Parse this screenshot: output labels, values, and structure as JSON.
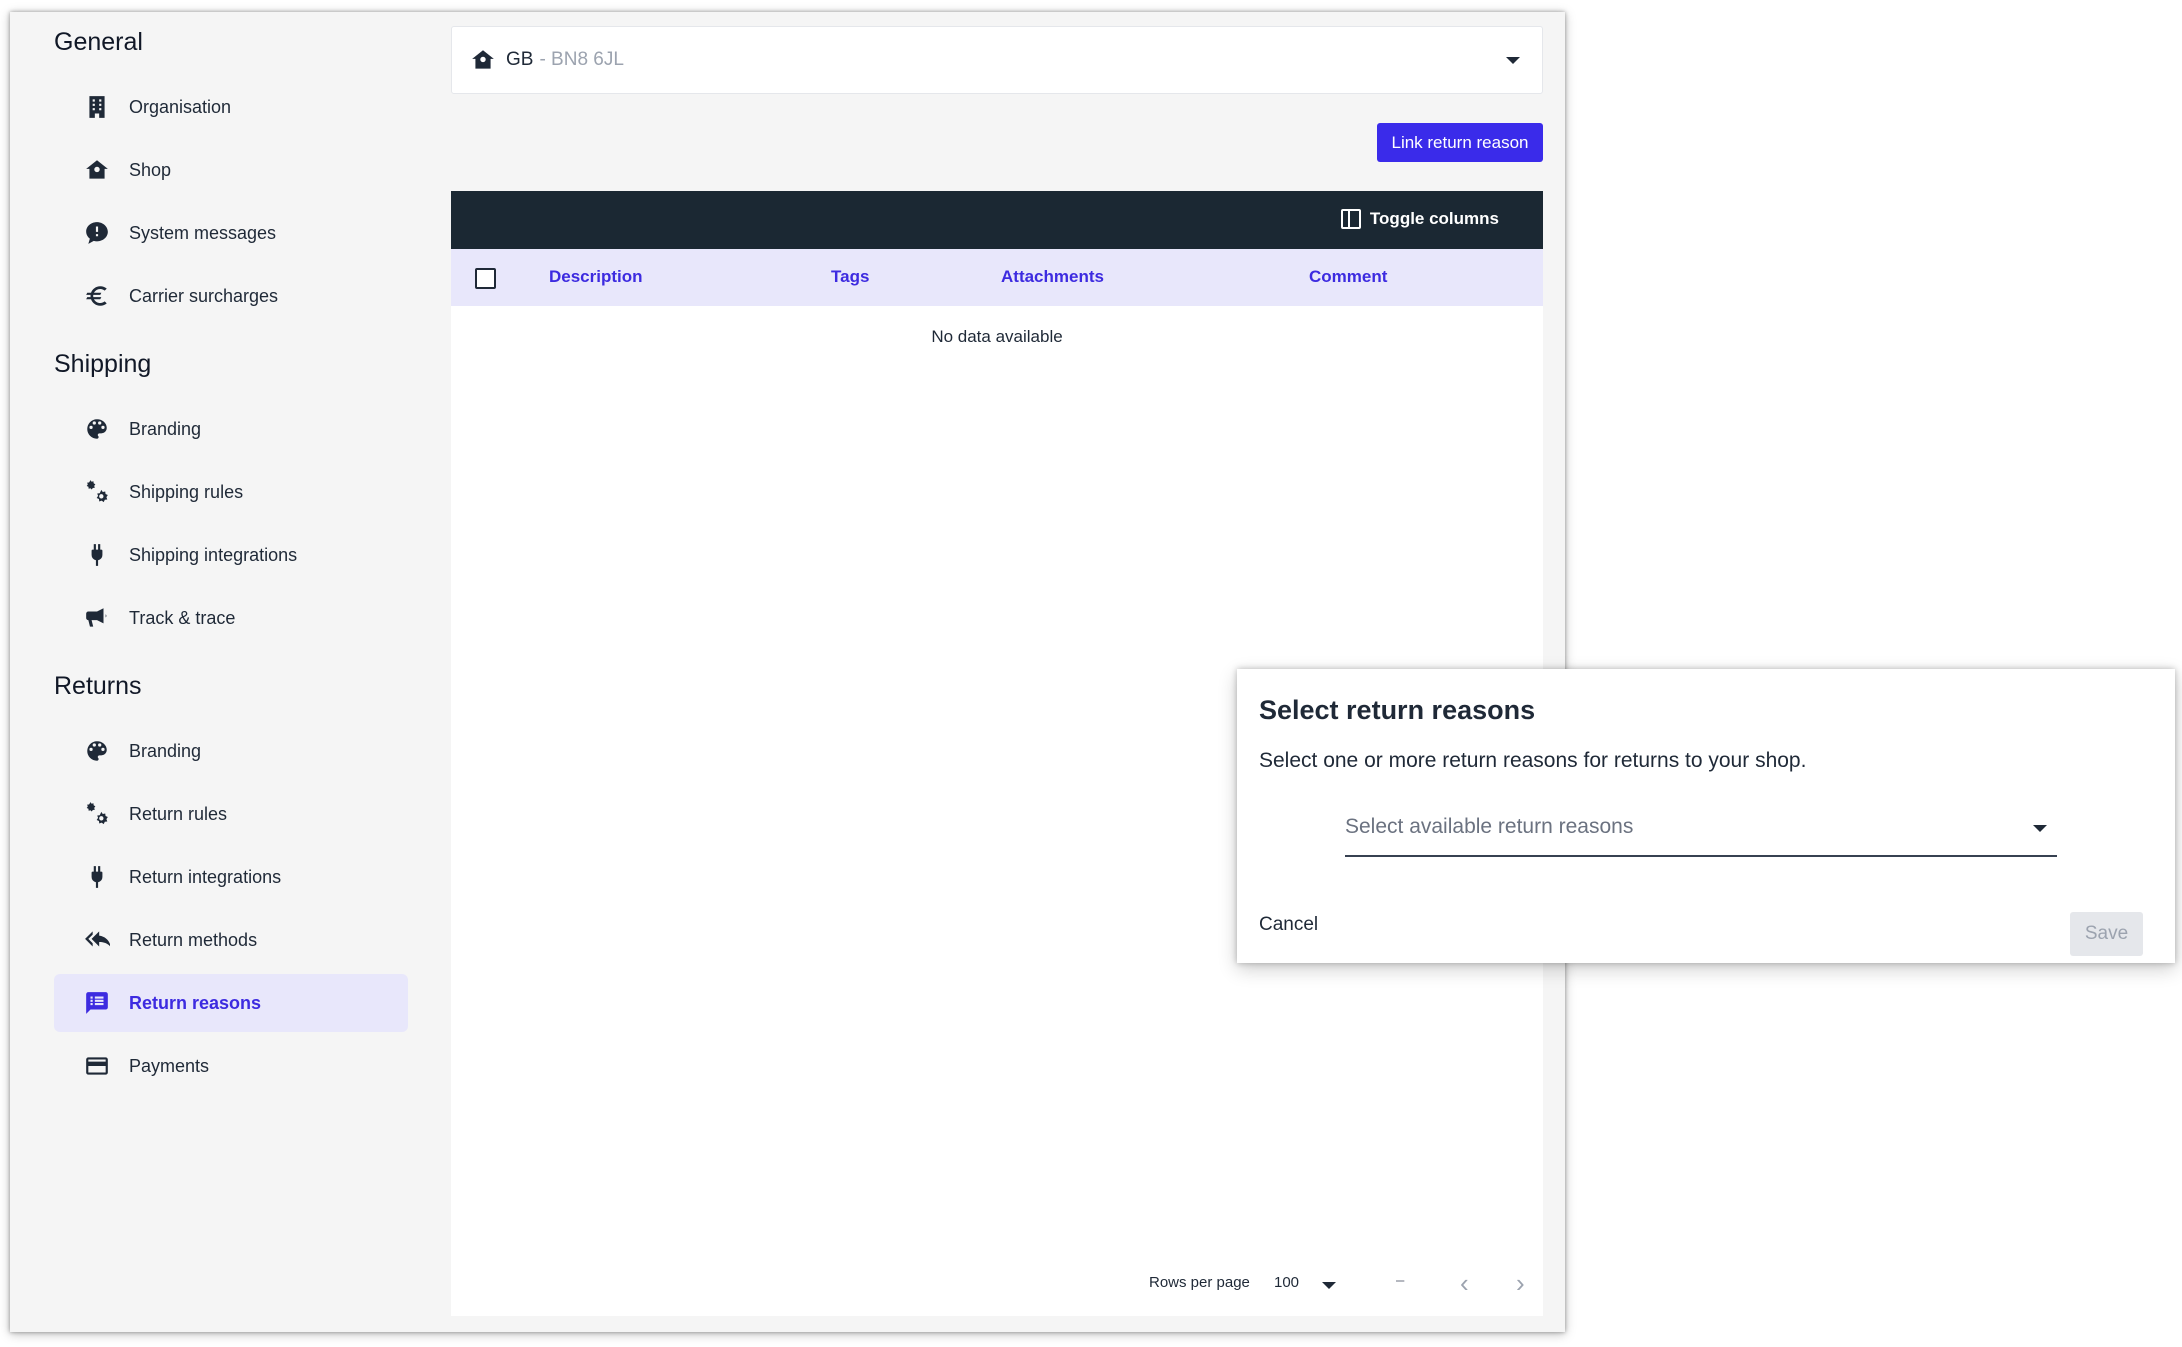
{
  "sidebar": {
    "sections": [
      {
        "title": "General",
        "items": [
          {
            "label": "Organisation",
            "icon": "building-icon"
          },
          {
            "label": "Shop",
            "icon": "home-icon"
          },
          {
            "label": "System messages",
            "icon": "message-alert-icon"
          },
          {
            "label": "Carrier surcharges",
            "icon": "euro-icon"
          }
        ]
      },
      {
        "title": "Shipping",
        "items": [
          {
            "label": "Branding",
            "icon": "palette-icon"
          },
          {
            "label": "Shipping rules",
            "icon": "cogs-icon"
          },
          {
            "label": "Shipping integrations",
            "icon": "plug-icon"
          },
          {
            "label": "Track & trace",
            "icon": "megaphone-icon"
          }
        ]
      },
      {
        "title": "Returns",
        "items": [
          {
            "label": "Branding",
            "icon": "palette-icon"
          },
          {
            "label": "Return rules",
            "icon": "cogs-icon"
          },
          {
            "label": "Return integrations",
            "icon": "plug-icon"
          },
          {
            "label": "Return methods",
            "icon": "reply-all-icon"
          },
          {
            "label": "Return reasons",
            "icon": "message-list-icon",
            "active": true
          },
          {
            "label": "Payments",
            "icon": "credit-card-icon"
          }
        ]
      }
    ]
  },
  "shop_select": {
    "country": "GB",
    "postcode": "- BN8 6JL"
  },
  "main": {
    "link_button": "Link return reason",
    "toggle_columns": "Toggle columns",
    "columns": [
      "Description",
      "Tags",
      "Attachments",
      "Comment"
    ],
    "empty_text": "No data available",
    "footer": {
      "rows_per_page_label": "Rows per page",
      "rows_per_page_value": "100",
      "range": "–",
      "prev": "‹",
      "next": "›"
    }
  },
  "dialog": {
    "title": "Select return reasons",
    "text": "Select one or more return reasons for returns to your shop.",
    "select_placeholder": "Select available return reasons",
    "cancel": "Cancel",
    "save": "Save"
  },
  "colors": {
    "accent": "#3a2bea",
    "toolbar": "#1b2833",
    "header_bg": "#e8e7fb"
  }
}
